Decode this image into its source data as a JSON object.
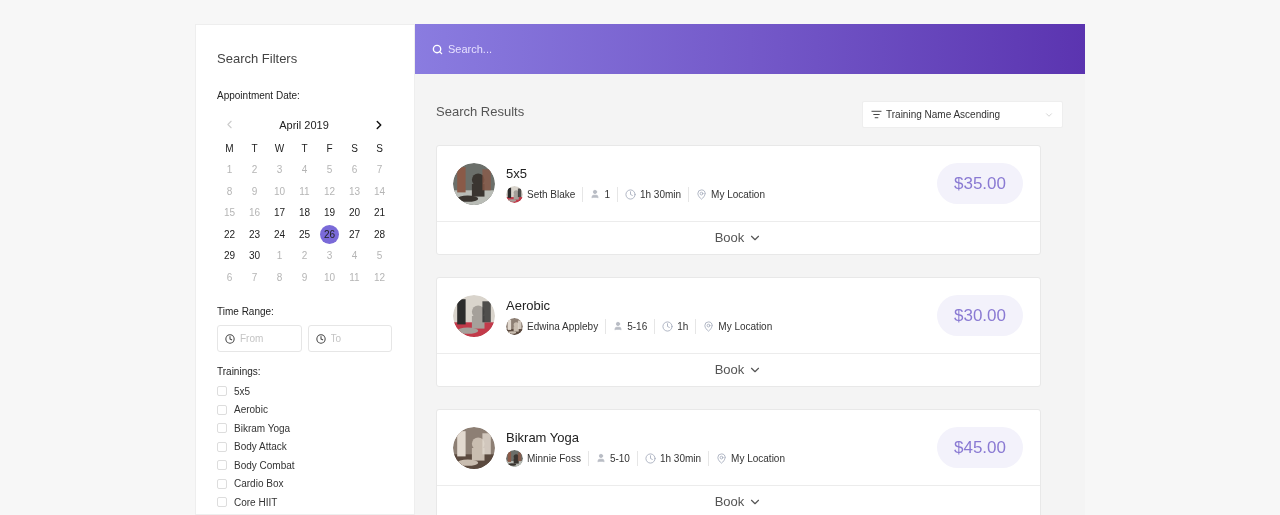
{
  "filters": {
    "title": "Search Filters",
    "date_label": "Appointment Date:",
    "calendar": {
      "month": "April 2019",
      "weekdays": [
        "M",
        "T",
        "W",
        "T",
        "F",
        "S",
        "S"
      ],
      "weeks": [
        [
          {
            "day": "1",
            "muted": true,
            "selected": false
          },
          {
            "day": "2",
            "muted": true,
            "selected": false
          },
          {
            "day": "3",
            "muted": true,
            "selected": false
          },
          {
            "day": "4",
            "muted": true,
            "selected": false
          },
          {
            "day": "5",
            "muted": true,
            "selected": false
          },
          {
            "day": "6",
            "muted": true,
            "selected": false
          },
          {
            "day": "7",
            "muted": true,
            "selected": false
          }
        ],
        [
          {
            "day": "8",
            "muted": true,
            "selected": false
          },
          {
            "day": "9",
            "muted": true,
            "selected": false
          },
          {
            "day": "10",
            "muted": true,
            "selected": false
          },
          {
            "day": "11",
            "muted": true,
            "selected": false
          },
          {
            "day": "12",
            "muted": true,
            "selected": false
          },
          {
            "day": "13",
            "muted": true,
            "selected": false
          },
          {
            "day": "14",
            "muted": true,
            "selected": false
          }
        ],
        [
          {
            "day": "15",
            "muted": true,
            "selected": false
          },
          {
            "day": "16",
            "muted": true,
            "selected": false
          },
          {
            "day": "17",
            "muted": false,
            "selected": false
          },
          {
            "day": "18",
            "muted": false,
            "selected": false
          },
          {
            "day": "19",
            "muted": false,
            "selected": false
          },
          {
            "day": "20",
            "muted": false,
            "selected": false
          },
          {
            "day": "21",
            "muted": false,
            "selected": false
          }
        ],
        [
          {
            "day": "22",
            "muted": false,
            "selected": false
          },
          {
            "day": "23",
            "muted": false,
            "selected": false
          },
          {
            "day": "24",
            "muted": false,
            "selected": false
          },
          {
            "day": "25",
            "muted": false,
            "selected": false
          },
          {
            "day": "26",
            "muted": false,
            "selected": true
          },
          {
            "day": "27",
            "muted": false,
            "selected": false
          },
          {
            "day": "28",
            "muted": false,
            "selected": false
          }
        ],
        [
          {
            "day": "29",
            "muted": false,
            "selected": false
          },
          {
            "day": "30",
            "muted": false,
            "selected": false
          },
          {
            "day": "1",
            "muted": true,
            "selected": false
          },
          {
            "day": "2",
            "muted": true,
            "selected": false
          },
          {
            "day": "3",
            "muted": true,
            "selected": false
          },
          {
            "day": "4",
            "muted": true,
            "selected": false
          },
          {
            "day": "5",
            "muted": true,
            "selected": false
          }
        ],
        [
          {
            "day": "6",
            "muted": true,
            "selected": false
          },
          {
            "day": "7",
            "muted": true,
            "selected": false
          },
          {
            "day": "8",
            "muted": true,
            "selected": false
          },
          {
            "day": "9",
            "muted": true,
            "selected": false
          },
          {
            "day": "10",
            "muted": true,
            "selected": false
          },
          {
            "day": "11",
            "muted": true,
            "selected": false
          },
          {
            "day": "12",
            "muted": true,
            "selected": false
          }
        ]
      ]
    },
    "time_label": "Time Range:",
    "time_from": {
      "placeholder": "From"
    },
    "time_to": {
      "placeholder": "To"
    },
    "trainings_label": "Trainings:",
    "trainings": [
      {
        "label": "5x5",
        "checked": false
      },
      {
        "label": "Aerobic",
        "checked": false
      },
      {
        "label": "Bikram Yoga",
        "checked": false
      },
      {
        "label": "Body Attack",
        "checked": false
      },
      {
        "label": "Body Combat",
        "checked": false
      },
      {
        "label": "Cardio Box",
        "checked": false
      },
      {
        "label": "Core HIIT",
        "checked": false
      }
    ]
  },
  "search": {
    "placeholder": "Search..."
  },
  "results": {
    "title": "Search Results",
    "sort": "Training Name Ascending",
    "items": [
      {
        "name": "5x5",
        "instructor": "Seth Blake",
        "capacity": "1",
        "duration": "1h 30min",
        "location": "My Location",
        "price": "$35.00",
        "action": "Book"
      },
      {
        "name": "Aerobic",
        "instructor": "Edwina Appleby",
        "capacity": "5-16",
        "duration": "1h",
        "location": "My Location",
        "price": "$30.00",
        "action": "Book"
      },
      {
        "name": "Bikram Yoga",
        "instructor": "Minnie Foss",
        "capacity": "5-10",
        "duration": "1h 30min",
        "location": "My Location",
        "price": "$45.00",
        "action": "Book"
      }
    ]
  }
}
